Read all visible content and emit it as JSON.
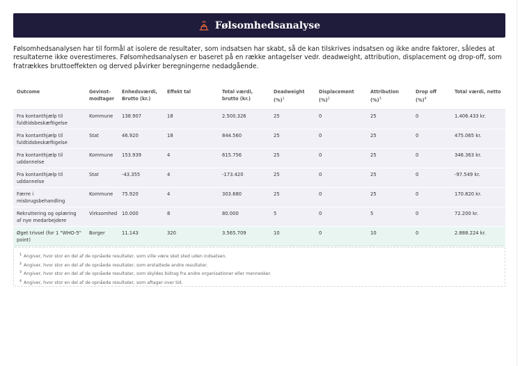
{
  "header": {
    "title": "Følsomhedsanalyse",
    "icon": "scale-icon",
    "bg": "#1f1b3a",
    "icon_color": "#e8693e"
  },
  "intro": "Følsomhedsanalysen har til formål at isolere de resultater, som indsatsen har skabt, så de kan tilskrives indsatsen og ikke andre faktorer, således at resultaterne ikke overestimeres. Følsomhedsanalysen er baseret på en række antagelser vedr. deadweight, attribution, displacement og drop-off, som fratrækkes bruttoeffekten og derved påvirker beregningerne nedadgående.",
  "table": {
    "headers": [
      {
        "label": "Outcome",
        "sup": ""
      },
      {
        "label": "Gevinst-modtager",
        "sup": ""
      },
      {
        "label": "Enhedsværdi, Brutto (kr.)",
        "sup": ""
      },
      {
        "label": "Effekt tal",
        "sup": ""
      },
      {
        "label": "Total værdi, brutto (kr.)",
        "sup": ""
      },
      {
        "label": "Deadweight (%)",
        "sup": "1"
      },
      {
        "label": "Displacement (%)",
        "sup": "2"
      },
      {
        "label": "Attribution (%)",
        "sup": "3"
      },
      {
        "label": "Drop off (%)",
        "sup": "4"
      },
      {
        "label": "Total værdi, netto",
        "sup": ""
      }
    ],
    "rows": [
      [
        "Fra kontanthjælp til fuldtidsbeskæftigelse",
        "Kommune",
        "138.907",
        "18",
        "2.500.326",
        "25",
        "0",
        "25",
        "0",
        "1.406.433 kr."
      ],
      [
        "Fra kontanthjælp til fuldtidsbeskæftigelse",
        "Stat",
        "46.920",
        "18",
        "844.560",
        "25",
        "0",
        "25",
        "0",
        "475.065 kr."
      ],
      [
        "Fra kontanthjælp til uddannelse",
        "Kommune",
        "153.939",
        "4",
        "615.756",
        "25",
        "0",
        "25",
        "0",
        "346.363 kr."
      ],
      [
        "Fra kontanthjælp til uddannelse",
        "Stat",
        "-43.355",
        "4",
        "-173.420",
        "25",
        "0",
        "25",
        "0",
        "-97.549 kr."
      ],
      [
        "Færre i misbrugsbehandling",
        "Kommune",
        "75.920",
        "4",
        "303.680",
        "25",
        "0",
        "25",
        "0",
        "170.820 kr."
      ],
      [
        "Rekruttering og oplæring af nye medarbejdere",
        "Virksomhed",
        "10.000",
        "8",
        "80.000",
        "5",
        "0",
        "5",
        "0",
        "72.200 kr."
      ],
      [
        "Øget trivsel (for 1 \"WHO-5\" point)",
        "Borger",
        "11.143",
        "320",
        "3.565.709",
        "10",
        "0",
        "10",
        "0",
        "2.888.224 kr."
      ]
    ],
    "highlight_row": 6,
    "highlight_color": "#e9f5f1"
  },
  "notes": [
    {
      "sup": "1",
      "text": "Angiver, hvor stor en del af de opnåede resultater, som ville være sket sted uden indsatsen."
    },
    {
      "sup": "2",
      "text": "Angiver, hvor stor en del af de opnåede resultater, som erstattede andre resultater."
    },
    {
      "sup": "3",
      "text": "Angiver, hvor stor en del af de opnåede resultater, som skyldes bidrag fra andre organisationer eller mennesker."
    },
    {
      "sup": "4",
      "text": "Angiver, hvor stor en del af de opnåede resultater, som aftager over tid."
    }
  ]
}
